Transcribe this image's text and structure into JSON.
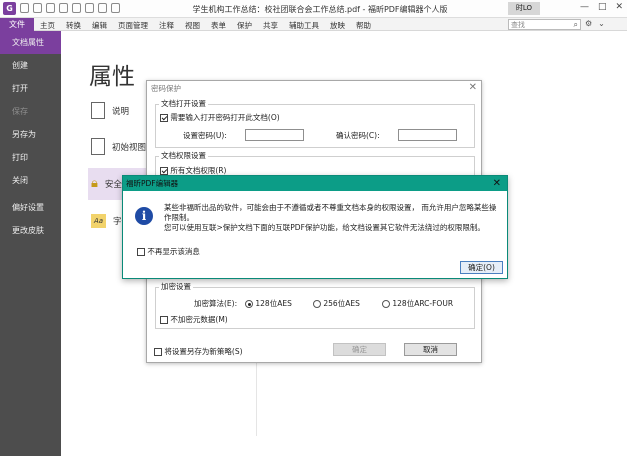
{
  "window": {
    "title": "学生机构工作总结：校社团联合会工作总结.pdf - 福昕PDF编辑器个人版",
    "user": "时LO",
    "minimize": "—",
    "maximize": "□",
    "close": "✕"
  },
  "menubar": {
    "file": "文件",
    "items": [
      "主页",
      "转换",
      "编辑",
      "页面管理",
      "注释",
      "视图",
      "表单",
      "保护",
      "共享",
      "辅助工具",
      "放映",
      "帮助"
    ],
    "search_placeholder": "查找"
  },
  "leftnav": {
    "items": [
      "文档属性",
      "创建",
      "打开",
      "保存",
      "另存为",
      "打印",
      "关闭",
      "偏好设置",
      "更改皮肤"
    ]
  },
  "content": {
    "heading": "属性",
    "props": [
      "说明",
      "初始视图",
      "安全",
      "字体"
    ]
  },
  "password_dialog": {
    "title": "密码保护",
    "open_group": "文档打开设置",
    "require_open_pwd": "需要输入打开密码打开此文档(O)",
    "set_pwd_label": "设置密码(U):",
    "confirm_pwd_label": "确认密码(C):",
    "perm_group": "文档权限设置",
    "all_perm": "所有文档权限(R)",
    "encrypt_group": "加密设置",
    "algo_label": "加密算法(E):",
    "algos": [
      "128位AES",
      "256位AES",
      "128位ARC-FOUR"
    ],
    "no_encrypt_meta": "不加密元数据(M)",
    "save_policy": "将设置另存为新策略(S)",
    "ok": "确定",
    "cancel": "取消"
  },
  "alert": {
    "title": "福昕PDF编辑器",
    "message_1": "某些非福昕出品的软件，可能会由于不遵循或者不尊重文档本身的权限设置， 而允许用户忽略某些操作限制。",
    "message_2": "您可以使用互联>保护文档下面的互联PDF保护功能，给文档设置其它软件无法绕过的权限限制。",
    "dont_show": "不再显示该消息",
    "ok": "确定(O)"
  }
}
